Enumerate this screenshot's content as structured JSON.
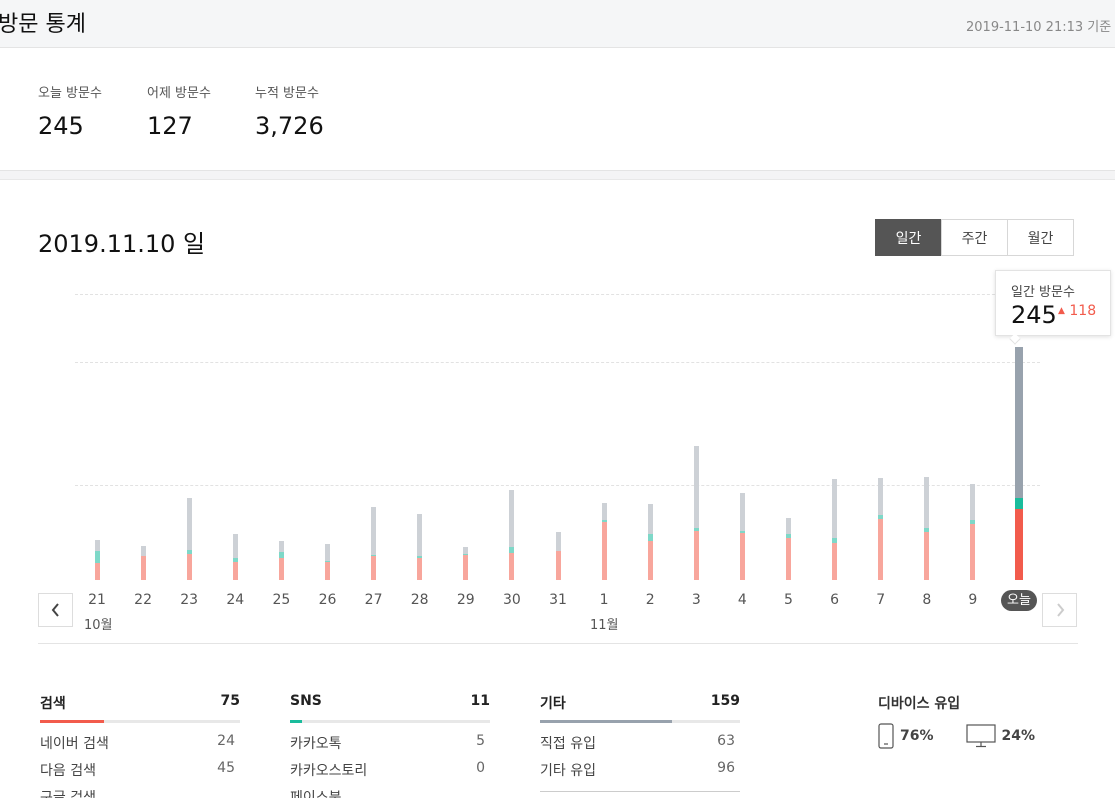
{
  "header": {
    "title": "방문 통계",
    "as_of": "2019-11-10 21:13 기준"
  },
  "summary": [
    {
      "label": "오늘 방문수",
      "value": "245"
    },
    {
      "label": "어제 방문수",
      "value": "127"
    },
    {
      "label": "누적 방문수",
      "value": "3,726"
    }
  ],
  "chart_title": "2019.11.10 일",
  "period_tabs": {
    "daily": "일간",
    "weekly": "주간",
    "monthly": "월간",
    "selected": "일간"
  },
  "tooltip": {
    "label": "일간 방문수",
    "value": "245",
    "delta": "118"
  },
  "chart_data": {
    "type": "bar",
    "stacked": true,
    "categories": [
      "21",
      "22",
      "23",
      "24",
      "25",
      "26",
      "27",
      "28",
      "29",
      "30",
      "31",
      "1",
      "2",
      "3",
      "4",
      "5",
      "6",
      "7",
      "8",
      "9",
      "오늘"
    ],
    "month_labels": {
      "first": "10월",
      "second": "11월"
    },
    "series": [
      {
        "key": "검색",
        "values": [
          18,
          25,
          27,
          19,
          23,
          19,
          25,
          23,
          26,
          28,
          30,
          61,
          41,
          52,
          49,
          44,
          39,
          64,
          50,
          59,
          75
        ]
      },
      {
        "key": "SNS",
        "values": [
          13,
          0,
          5,
          4,
          6,
          1,
          1,
          2,
          1,
          7,
          0,
          2,
          7,
          3,
          3,
          4,
          5,
          4,
          5,
          4,
          11
        ]
      },
      {
        "key": "기타",
        "values": [
          11,
          11,
          54,
          25,
          12,
          18,
          51,
          44,
          8,
          60,
          21,
          18,
          32,
          86,
          40,
          17,
          62,
          39,
          53,
          38,
          159
        ]
      }
    ],
    "ylim": [
      0,
      245
    ],
    "grid": true,
    "colors": {
      "search": "#f8a69c",
      "sns": "#7ed8c8",
      "etc": "#cdd1d6",
      "search_today": "#f25b4c",
      "sns_today": "#1abc9c",
      "etc_today": "#98a2ad"
    }
  },
  "referrers": {
    "search": {
      "title": "검색",
      "total": "75",
      "share": 0.32,
      "color": "#f25b4c",
      "rows": [
        {
          "name": "네이버 검색",
          "count": "24"
        },
        {
          "name": "다음 검색",
          "count": "45"
        },
        {
          "name": "구글 검색",
          "count": ""
        }
      ]
    },
    "sns": {
      "title": "SNS",
      "total": "11",
      "share": 0.06,
      "color": "#1abc9c",
      "rows": [
        {
          "name": "카카오톡",
          "count": "5"
        },
        {
          "name": "카카오스토리",
          "count": "0"
        },
        {
          "name": "페이스북",
          "count": ""
        }
      ]
    },
    "etc": {
      "title": "기타",
      "total": "159",
      "share": 0.66,
      "color": "#98a2ad",
      "rows": [
        {
          "name": "직접 유입",
          "count": "63"
        },
        {
          "name": "기타 유입",
          "count": "96"
        }
      ]
    }
  },
  "device": {
    "title": "디바이스 유입",
    "mobile": "76%",
    "pc": "24%"
  }
}
